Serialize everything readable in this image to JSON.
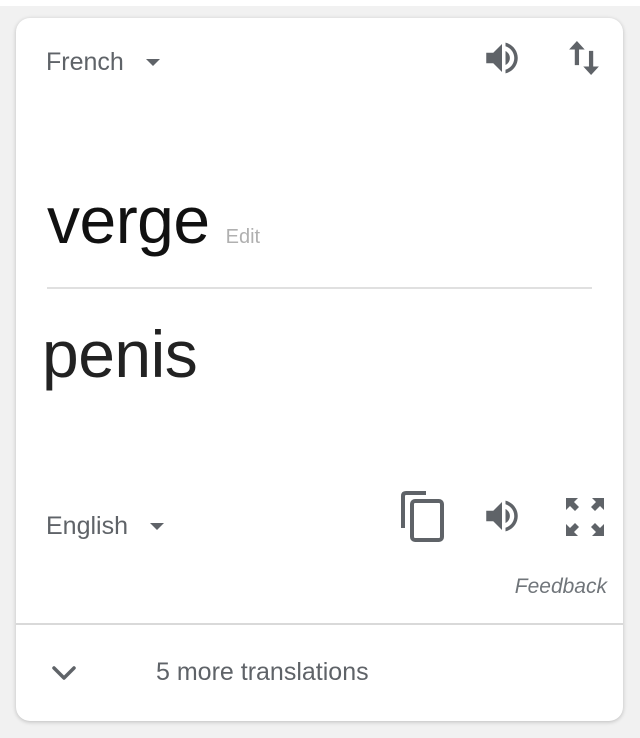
{
  "source": {
    "language": "French",
    "word": "verge",
    "edit_label": "Edit"
  },
  "target": {
    "language": "English",
    "word": "penis"
  },
  "feedback_label": "Feedback",
  "more_translations_label": "5 more translations",
  "icons": {
    "source_speaker": "volume-icon",
    "swap": "swap-languages-icon",
    "copy": "copy-icon",
    "target_speaker": "volume-icon",
    "fullscreen": "fullscreen-icon",
    "expand": "chevron-down-icon"
  },
  "colors": {
    "icon_gray": "#5f6368",
    "text_dark": "#111111",
    "edit_gray": "#b0b0b0"
  }
}
